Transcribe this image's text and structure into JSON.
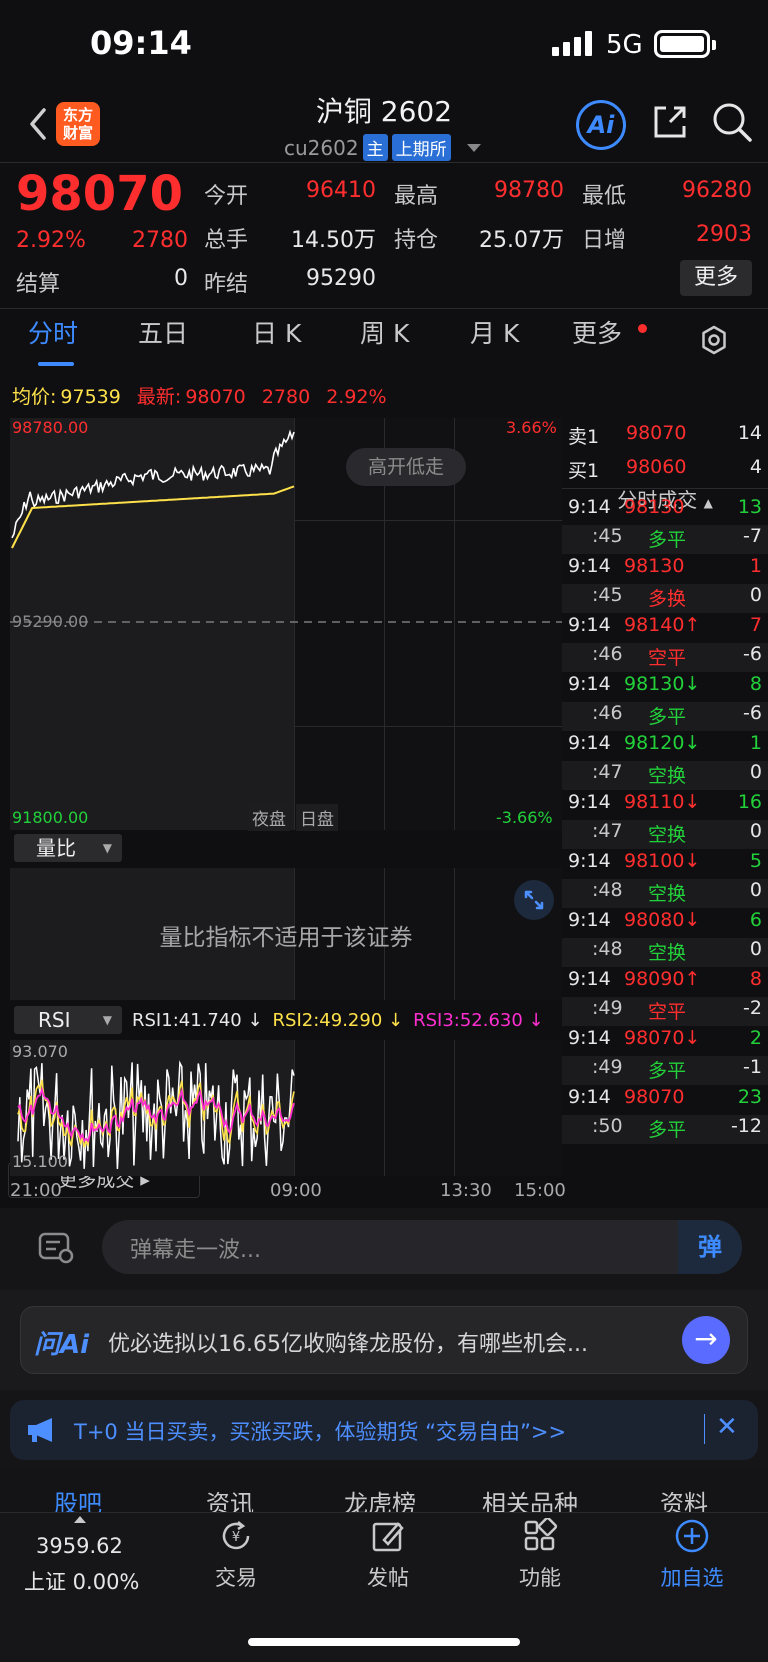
{
  "status": {
    "time": "09:14",
    "network": "5G"
  },
  "header": {
    "brand_logo": "东方财富",
    "title": "沪铜 2602",
    "code": "cu2602",
    "tag_main": "主",
    "tag_exchange": "上期所",
    "ai_label": "Ai"
  },
  "quote": {
    "price": "98070",
    "change_pct": "2.92%",
    "change": "2780",
    "open_label": "今开",
    "open": "96410",
    "high_label": "最高",
    "high": "98780",
    "low_label": "最低",
    "low": "96280",
    "volume_label": "总手",
    "volume": "14.50万",
    "oi_label": "持仓",
    "oi": "25.07万",
    "daily_inc_label": "日增",
    "daily_inc": "2903",
    "settle_label": "结算",
    "settle": "0",
    "prev_settle_label": "昨结",
    "prev_settle": "95290",
    "more": "更多"
  },
  "tabs": [
    "分时",
    "五日",
    "日 K",
    "周 K",
    "月 K",
    "更多"
  ],
  "summary": {
    "avg_label": "均价:",
    "avg": "97539",
    "latest_label": "最新:",
    "latest": "98070",
    "change": "2780",
    "pct": "2.92%"
  },
  "chart": {
    "y_high": "98780.00",
    "y_mid": "95290.00",
    "y_low": "91800.00",
    "pct_high": "3.66%",
    "pct_low": "-3.66%",
    "pattern_chip": "高开低走",
    "night": "夜盘",
    "day": "日盘",
    "x_ticks": [
      "21:00",
      "09:00",
      "13:30",
      "15:00"
    ]
  },
  "orderbook": [
    {
      "label": "卖1",
      "price": "98070",
      "qty": "14"
    },
    {
      "label": "买1",
      "price": "98060",
      "qty": "4"
    }
  ],
  "trades_header": "分时成交",
  "trades": [
    {
      "time": "9:14",
      "price": "98130",
      "arrow": "",
      "vol": "13",
      "pc": "red",
      "vc": "green",
      "sub_time": ":45",
      "type": "多平",
      "tc": "green",
      "delta": "-7"
    },
    {
      "time": "9:14",
      "price": "98130",
      "arrow": "",
      "vol": "1",
      "pc": "red",
      "vc": "red",
      "sub_time": ":45",
      "type": "多换",
      "tc": "red",
      "delta": "0"
    },
    {
      "time": "9:14",
      "price": "98140",
      "arrow": "↑",
      "vol": "7",
      "pc": "red",
      "vc": "red",
      "sub_time": ":46",
      "type": "空平",
      "tc": "red",
      "delta": "-6"
    },
    {
      "time": "9:14",
      "price": "98130",
      "arrow": "↓",
      "vol": "8",
      "pc": "green",
      "vc": "green",
      "sub_time": ":46",
      "type": "多平",
      "tc": "green",
      "delta": "-6"
    },
    {
      "time": "9:14",
      "price": "98120",
      "arrow": "↓",
      "vol": "1",
      "pc": "green",
      "vc": "green",
      "sub_time": ":47",
      "type": "空换",
      "tc": "green",
      "delta": "0"
    },
    {
      "time": "9:14",
      "price": "98110",
      "arrow": "↓",
      "vol": "16",
      "pc": "red",
      "vc": "green",
      "sub_time": ":47",
      "type": "空换",
      "tc": "green",
      "delta": "0"
    },
    {
      "time": "9:14",
      "price": "98100",
      "arrow": "↓",
      "vol": "5",
      "pc": "red",
      "vc": "green",
      "sub_time": ":48",
      "type": "空换",
      "tc": "green",
      "delta": "0"
    },
    {
      "time": "9:14",
      "price": "98080",
      "arrow": "↓",
      "vol": "6",
      "pc": "red",
      "vc": "green",
      "sub_time": ":48",
      "type": "空换",
      "tc": "green",
      "delta": "0"
    },
    {
      "time": "9:14",
      "price": "98090",
      "arrow": "↑",
      "vol": "8",
      "pc": "red",
      "vc": "red",
      "sub_time": ":49",
      "type": "空平",
      "tc": "red",
      "delta": "-2"
    },
    {
      "time": "9:14",
      "price": "98070",
      "arrow": "↓",
      "vol": "2",
      "pc": "red",
      "vc": "green",
      "sub_time": ":49",
      "type": "多平",
      "tc": "green",
      "delta": "-1"
    },
    {
      "time": "9:14",
      "price": "98070",
      "arrow": "",
      "vol": "23",
      "pc": "red",
      "vc": "green",
      "sub_time": ":50",
      "type": "多平",
      "tc": "green",
      "delta": "-12"
    }
  ],
  "more_trades": "更多成交 ▸",
  "volume_ratio": {
    "label": "量比",
    "message": "量比指标不适用于该证券"
  },
  "rsi": {
    "label": "RSI",
    "rsi1": "RSI1:41.740 ↓",
    "rsi2": "RSI2:49.290 ↓",
    "rsi3": "RSI3:52.630 ↓",
    "y_high": "93.070",
    "y_low": "15.100"
  },
  "danmu": {
    "placeholder": "弹幕走一波...",
    "send": "弹"
  },
  "ai_ask": {
    "logo": "问Ai",
    "text": "优必选拟以16.65亿收购锋龙股份，有哪些机会..."
  },
  "promo": {
    "text": "T+0 当日买卖，买涨买跌，体验期货 “交易自由”>>"
  },
  "subtabs": [
    "股吧",
    "资讯",
    "龙虎榜",
    "相关品种",
    "资料"
  ],
  "bottom": {
    "index_value": "3959.62",
    "index_name": "上证  0.00%",
    "items": [
      "交易",
      "发帖",
      "功能",
      "加自选"
    ]
  },
  "colors": {
    "up": "#ff2e2e",
    "down": "#22d13a",
    "accent": "#3d8bff",
    "avg_line": "#ffe14a",
    "rsi3": "#ff2ed0"
  }
}
